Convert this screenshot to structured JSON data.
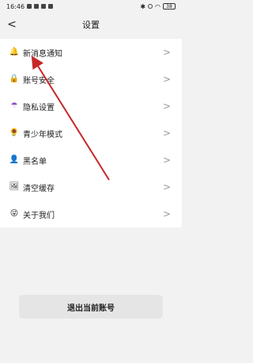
{
  "status": {
    "time": "16:46",
    "battery": "38"
  },
  "nav": {
    "title": "设置",
    "back_glyph": "<"
  },
  "menu": [
    {
      "label": "新消息通知",
      "icon": "notification-icon",
      "glyph": "🔔",
      "color": "#e0a21a"
    },
    {
      "label": "账号安全",
      "icon": "lock-icon",
      "glyph": "🔒",
      "color": "#e8a12a"
    },
    {
      "label": "隐私设置",
      "icon": "umbrella-icon",
      "glyph": "☂",
      "color": "#8a4fc2"
    },
    {
      "label": "青少年模式",
      "icon": "sunflower-icon",
      "glyph": "🌻",
      "color": "#e8a12a"
    },
    {
      "label": "黑名单",
      "icon": "user-icon",
      "glyph": "👤",
      "color": "#2b5fa8"
    },
    {
      "label": "清空缓存",
      "icon": "image-icon",
      "glyph": "🖼",
      "color": "#4a90d9"
    },
    {
      "label": "关于我们",
      "icon": "smiley-icon",
      "glyph": "😜",
      "color": "#e8a12a"
    }
  ],
  "chevron": ">",
  "logout": {
    "label": "退出当前账号"
  },
  "colors": {
    "annotation_arrow": "#c62828",
    "background": "#f2f2f2"
  }
}
